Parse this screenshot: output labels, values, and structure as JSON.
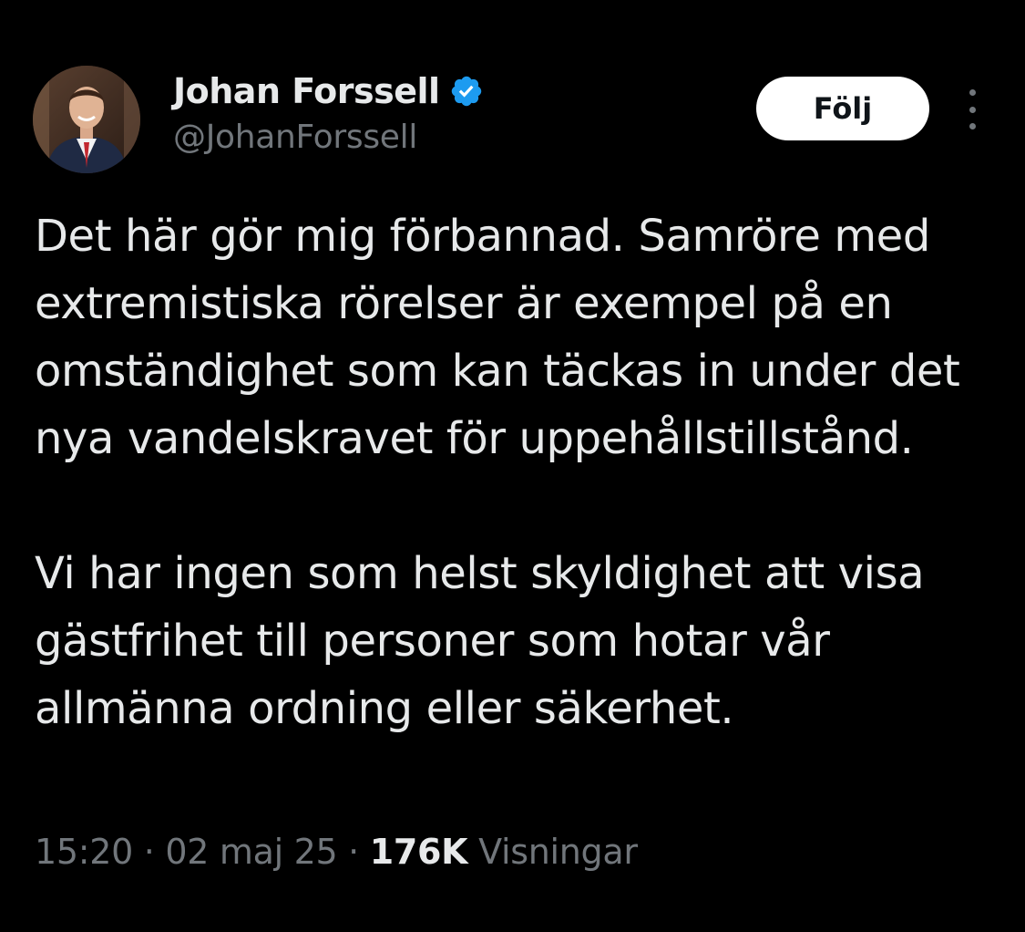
{
  "author": {
    "display_name": "Johan Forssell",
    "handle": "@JohanForssell",
    "verified_icon": "verified-badge-icon",
    "avatar_icon": "profile-photo"
  },
  "actions": {
    "follow_label": "Följ",
    "more_icon": "more-options-icon"
  },
  "tweet": {
    "paragraphs": [
      "Det här gör mig förbannad. Samröre med extremistiska rörelser är exempel på en omständighet som kan täckas in under det nya vandelskravet för uppehållstillstånd.",
      "Vi har ingen som helst skyldighet att visa gästfrihet till personer som hotar vår allmänna ordning eller säkerhet."
    ],
    "time": "15:20",
    "separator": "·",
    "date": "02 maj 25",
    "views_count": "176K",
    "views_label": "Visningar"
  },
  "colors": {
    "background": "#000000",
    "text": "#e7e9ea",
    "muted": "#71767b",
    "verified": "#1d9bf0",
    "button_bg": "#ffffff"
  }
}
